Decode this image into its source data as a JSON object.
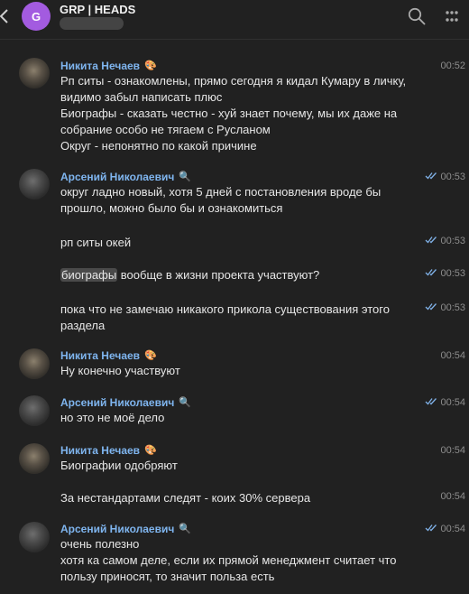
{
  "header": {
    "title": "GRP | HEADS",
    "avatar_letter": "G",
    "avatar_color": "#a35be0"
  },
  "icons": {
    "back": "chevron-left-icon",
    "search": "search-icon",
    "more": "more-vertical-icon",
    "read": "double-check-icon"
  },
  "colors": {
    "author": "#7fb5ef",
    "read_check": "#7fb0e6",
    "background": "#212121"
  },
  "messages": [
    {
      "author": "Никита Нечаев",
      "badge": "🎨",
      "time": "00:52",
      "read": false,
      "text": "Рп ситы - ознакомлены, прямо сегодня я кидал Кумару в личку,\nвидимо забыл написать плюс\nБиографы - сказать честно - хуй знает почему, мы их даже на\nсобрание особо не тягаем с Русланом\nОкруг - непонятно по какой причине"
    },
    {
      "author": "Арсений Николаевич",
      "badge": "🔍",
      "time": "00:53",
      "read": true,
      "text": "округ ладно новый, хотя 5 дней с постановления вроде бы\nпрошло, можно было бы и ознакомиться"
    },
    {
      "time": "00:53",
      "read": true,
      "text": "рп ситы окей"
    },
    {
      "time": "00:53",
      "read": true,
      "highlight": "биографы",
      "rest": " вообще в жизни проекта участвуют?"
    },
    {
      "time": "00:53",
      "read": true,
      "text": "пока что не замечаю никакого прикола существования этого\nраздела"
    },
    {
      "author": "Никита Нечаев",
      "badge": "🎨",
      "time": "00:54",
      "read": false,
      "text": "Ну конечно участвуют"
    },
    {
      "author": "Арсений Николаевич",
      "badge": "🔍",
      "time": "00:54",
      "read": true,
      "text": "но это не моё дело"
    },
    {
      "author": "Никита Нечаев",
      "badge": "🎨",
      "time": "00:54",
      "read": false,
      "text": "Биографии одобряют"
    },
    {
      "time": "00:54",
      "read": false,
      "text": "За нестандартами следят - коих 30% сервера"
    },
    {
      "author": "Арсений Николаевич",
      "badge": "🔍",
      "time": "00:54",
      "read": true,
      "text": "очень полезно\nхотя ка самом деле, если их прямой менеджмент считает что\nпользу приносят, то значит польза есть"
    }
  ]
}
